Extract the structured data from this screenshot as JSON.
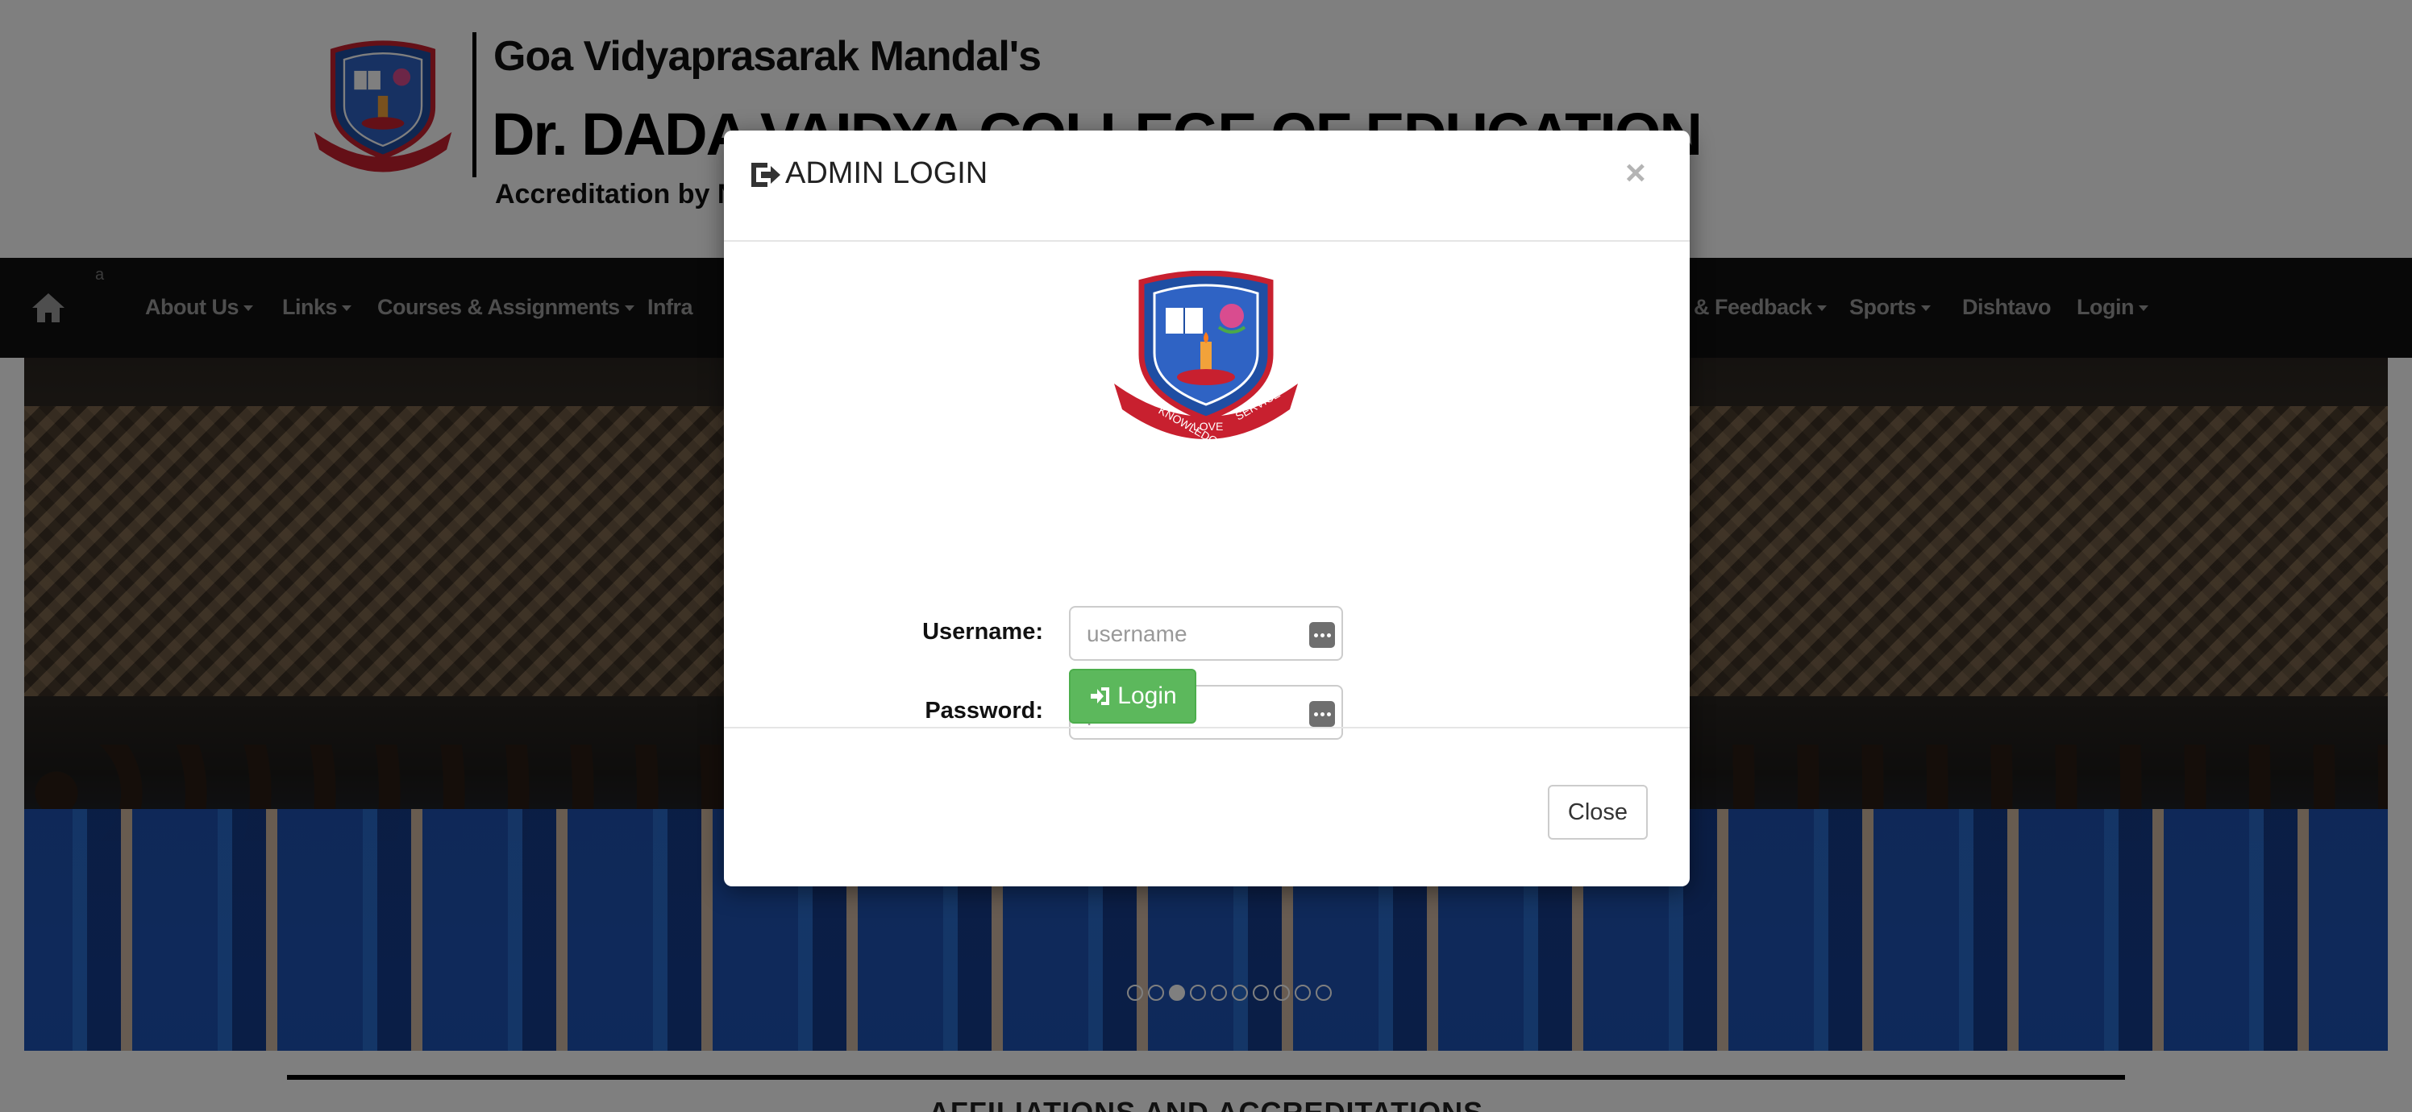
{
  "header": {
    "org": "Goa Vidyaprasarak Mandal's",
    "college": "Dr. DADA VAIDYA COLLEGE OF EDUCATION",
    "accreditation": "Accreditation by N"
  },
  "nav": {
    "home_icon": "home-icon",
    "stray_text": "a",
    "items": [
      {
        "label": "About Us",
        "dropdown": true
      },
      {
        "label": "Links",
        "dropdown": true
      },
      {
        "label": "Courses & Assignments",
        "dropdown": true
      },
      {
        "label": "Infra",
        "dropdown": false
      },
      {
        "label": "& Feedback",
        "dropdown": true
      },
      {
        "label": "Sports",
        "dropdown": true
      },
      {
        "label": "Dishtavo",
        "dropdown": false
      },
      {
        "label": "Login",
        "dropdown": true
      }
    ]
  },
  "carousel": {
    "slide_count": 10,
    "active_index": 2
  },
  "footer": {
    "section_title": "AFFILIATIONS AND ACCREDITATIONS"
  },
  "modal": {
    "title": "ADMIN LOGIN",
    "title_icon": "sign-in-icon",
    "close_symbol": "×",
    "username_label": "Username:",
    "username_placeholder": "username",
    "username_value": "",
    "password_label": "Password:",
    "password_placeholder": "password",
    "password_value": "",
    "login_label": "Login",
    "close_label": "Close"
  },
  "crest_text": {
    "left": "KNOWLEDGE",
    "middle": "LOVE",
    "right": "SERVICE"
  },
  "colors": {
    "nav_bg": "#101010",
    "nav_text": "#9d9d9d",
    "login_green": "#5cb85c",
    "crest_blue": "#1f4ea3",
    "crest_red": "#c8202f"
  }
}
